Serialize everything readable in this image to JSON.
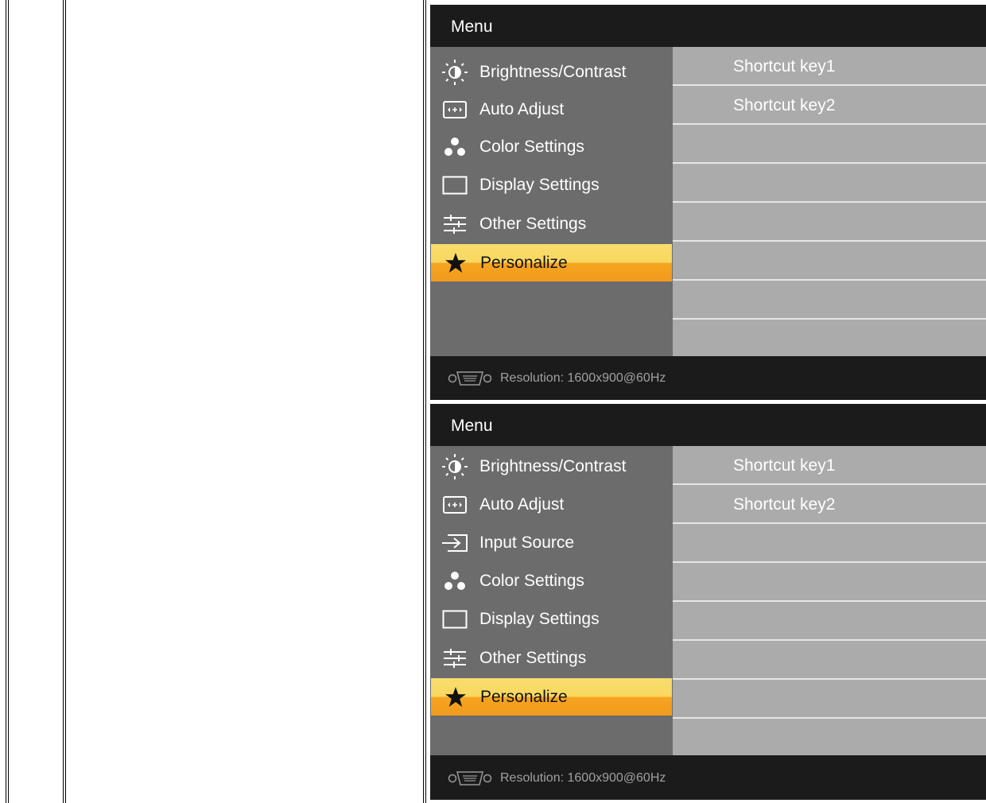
{
  "panels": [
    {
      "title": "Menu",
      "menu": [
        {
          "label": "Brightness/Contrast",
          "icon": "brightness-icon"
        },
        {
          "label": "Auto Adjust",
          "icon": "auto-adjust-icon"
        },
        {
          "label": "Color Settings",
          "icon": "color-settings-icon"
        },
        {
          "label": "Display Settings",
          "icon": "display-settings-icon"
        },
        {
          "label": "Other Settings",
          "icon": "other-settings-icon"
        },
        {
          "label": "Personalize",
          "icon": "star-icon",
          "selected": true
        }
      ],
      "shortcuts": [
        "Shortcut key1",
        "Shortcut key2"
      ],
      "resolution": "Resolution:  1600x900@60Hz"
    },
    {
      "title": "Menu",
      "menu": [
        {
          "label": "Brightness/Contrast",
          "icon": "brightness-icon"
        },
        {
          "label": "Auto Adjust",
          "icon": "auto-adjust-icon"
        },
        {
          "label": "Input Source",
          "icon": "input-source-icon"
        },
        {
          "label": "Color Settings",
          "icon": "color-settings-icon"
        },
        {
          "label": "Display Settings",
          "icon": "display-settings-icon"
        },
        {
          "label": "Other Settings",
          "icon": "other-settings-icon"
        },
        {
          "label": "Personalize",
          "icon": "star-icon",
          "selected": true
        }
      ],
      "shortcuts": [
        "Shortcut key1",
        "Shortcut key2"
      ],
      "resolution": "Resolution:  1600x900@60Hz"
    }
  ],
  "colors": {
    "osd_background": "#1b1b1b",
    "menu_column": "#6c6c6c",
    "submenu_column": "#ababab",
    "selected_top": "#f8dc6c",
    "selected_bottom": "#f29a1e"
  }
}
